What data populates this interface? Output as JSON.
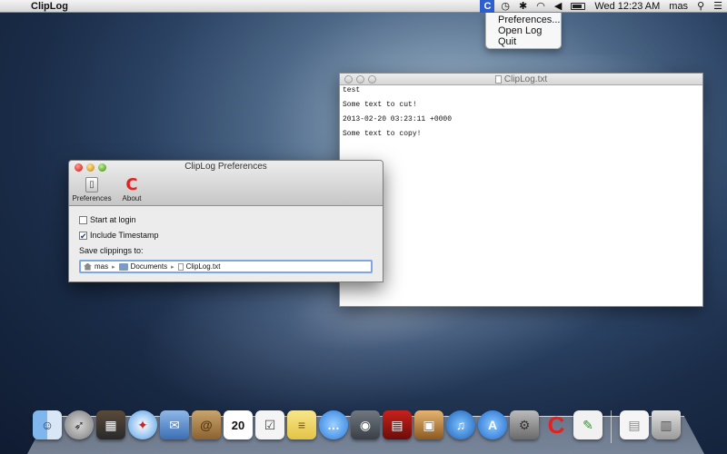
{
  "menubar": {
    "app_name": "ClipLog",
    "status_item_label": "C",
    "clock": "Wed 12:23 AM",
    "user": "mas",
    "icons": [
      "apple-icon",
      "time-machine-icon",
      "bluetooth-icon",
      "wifi-icon",
      "volume-icon",
      "battery-icon",
      "spotlight-icon",
      "notification-center-icon"
    ]
  },
  "status_menu": {
    "items": [
      "Preferences...",
      "Open Log",
      "Quit"
    ]
  },
  "log_window": {
    "title": "ClipLog.txt",
    "lines": [
      "test",
      "",
      "Some text to cut!",
      "",
      "2013-02-20 03:23:11 +0000",
      "",
      "Some text to copy!"
    ]
  },
  "prefs_window": {
    "title": "ClipLog Preferences",
    "toolbar": {
      "preferences_label": "Preferences",
      "about_label": "About"
    },
    "start_at_login": {
      "label": "Start at login",
      "checked": false
    },
    "include_timestamp": {
      "label": "Include Timestamp",
      "checked": true
    },
    "save_label": "Save clippings to:",
    "path": [
      "mas",
      "Documents",
      "ClipLog.txt"
    ]
  },
  "dock": {
    "items": [
      "Finder",
      "Launchpad",
      "Mission Control",
      "Safari",
      "Mail",
      "Contacts",
      "Calendar",
      "Reminders",
      "Notes",
      "Messages",
      "FaceTime",
      "Photo Booth",
      "iPhoto",
      "iTunes",
      "App Store",
      "System Preferences",
      "ClipLog",
      "Preview",
      "Documents",
      "Trash"
    ],
    "calendar_date": "20"
  },
  "colors": {
    "accent": "#2f5fcf",
    "cliplog_red": "#e32121",
    "focus_ring": "#7ea6e0"
  }
}
